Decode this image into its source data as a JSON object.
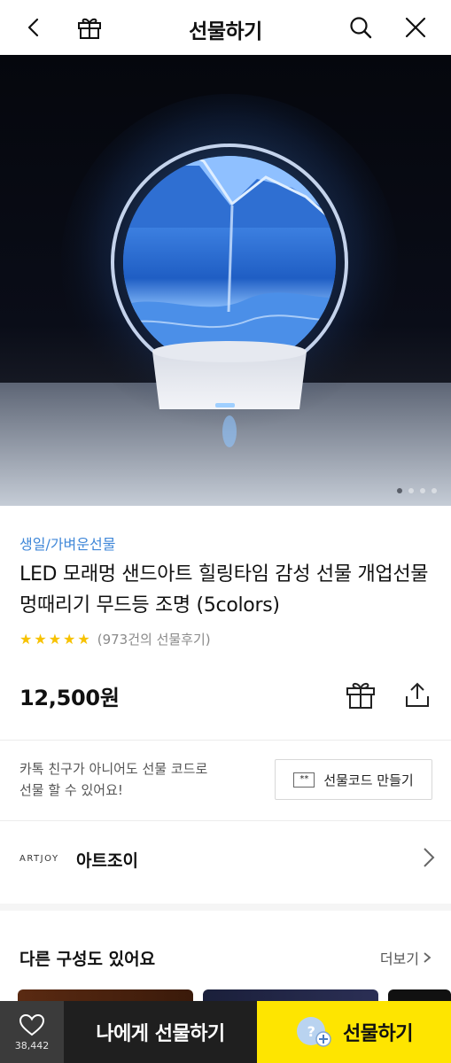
{
  "header": {
    "title": "선물하기"
  },
  "product": {
    "category": "생일/가벼운선물",
    "title": "LED 모래멍 샌드아트 힐링타임 감성 선물 개업선물 멍때리기 무드등 조명 (5colors)",
    "rating": 5,
    "review_text": "(973건의 선물후기)",
    "price": "12,500원",
    "image_count": 4,
    "image_index": 1
  },
  "gift_code": {
    "text_line1": "카톡 친구가 아니어도 선물 코드로",
    "text_line2": "선물 할 수 있어요!",
    "button_badge": "**",
    "button_label": "선물코드 만들기"
  },
  "brand": {
    "logo_text": "ARTJOY",
    "name": "아트조이"
  },
  "other_options": {
    "title": "다른 구성도 있어요",
    "more_label": "더보기"
  },
  "bottom_bar": {
    "wish_count": "38,442",
    "self_gift_label": "나에게 선물하기",
    "gift_label": "선물하기"
  },
  "colors": {
    "accent_yellow": "#fee500",
    "category_blue": "#3f87d8",
    "star": "#f7c200"
  }
}
